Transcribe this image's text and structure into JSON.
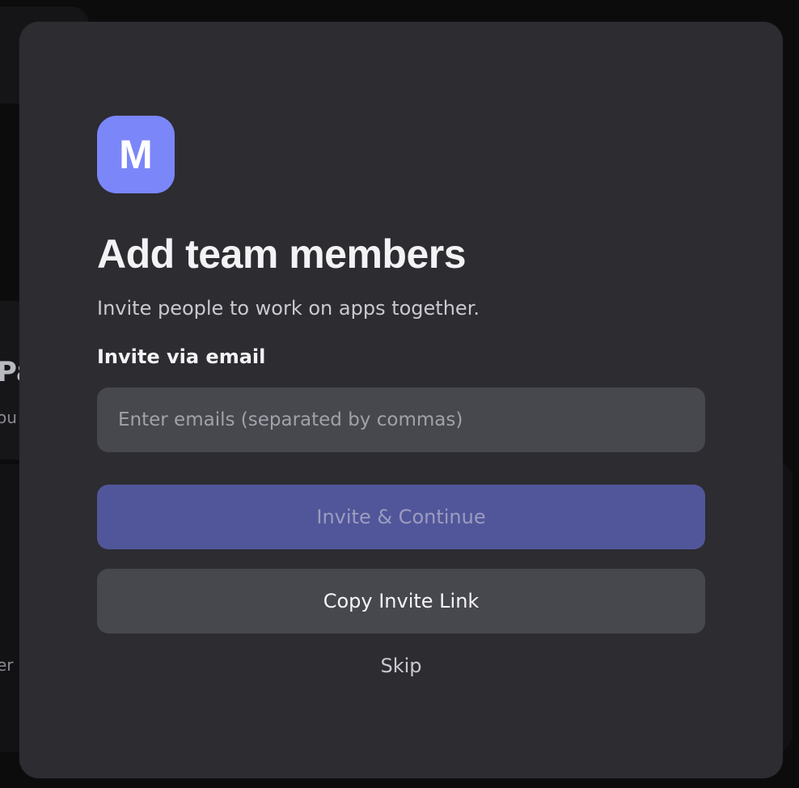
{
  "background": {
    "partial_heading": "Pa",
    "partial_line_1": "ou",
    "partial_line_2": "er"
  },
  "modal": {
    "logo_letter": "M",
    "title": "Add team members",
    "subtitle": "Invite people to work on apps together.",
    "email_label": "Invite via email",
    "email_value": "",
    "email_placeholder": "Enter emails (separated by commas)",
    "invite_button_label": "Invite & Continue",
    "copy_link_button_label": "Copy Invite Link",
    "skip_label": "Skip"
  },
  "colors": {
    "accent": "#7b86f9",
    "primary_button_disabled": "#51569a",
    "modal_background": "#2c2c31",
    "input_background": "#47474e"
  }
}
